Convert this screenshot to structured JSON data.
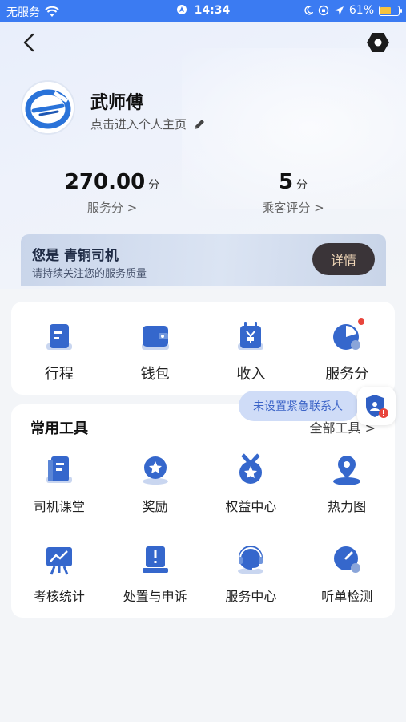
{
  "status_bar": {
    "carrier": "无服务",
    "time": "14:34",
    "battery": "61%",
    "battery_level": 0.61
  },
  "profile": {
    "name": "武师傅",
    "subtitle": "点击进入个人主页"
  },
  "stats": [
    {
      "value": "270.00",
      "unit": "分",
      "label": "服务分 >"
    },
    {
      "value": "5",
      "unit": "分",
      "label": "乘客评分 >"
    }
  ],
  "level_banner": {
    "title": "您是 青铜司机",
    "subtitle": "请持续关注您的服务质量",
    "detail_label": "详情"
  },
  "quick_items": [
    {
      "label": "行程",
      "icon": "itinerary-icon"
    },
    {
      "label": "钱包",
      "icon": "wallet-icon"
    },
    {
      "label": "收入",
      "icon": "income-icon"
    },
    {
      "label": "服务分",
      "icon": "service-score-icon",
      "has_badge": true
    }
  ],
  "tools": {
    "title": "常用工具",
    "all_label": "全部工具 >",
    "items": [
      {
        "label": "司机课堂",
        "icon": "driver-class-icon"
      },
      {
        "label": "奖励",
        "icon": "reward-icon"
      },
      {
        "label": "权益中心",
        "icon": "benefits-icon"
      },
      {
        "label": "热力图",
        "icon": "heatmap-icon"
      },
      {
        "label": "考核统计",
        "icon": "assessment-stats-icon"
      },
      {
        "label": "处置与申诉",
        "icon": "appeal-icon"
      },
      {
        "label": "服务中心",
        "icon": "service-center-icon"
      },
      {
        "label": "听单检测",
        "icon": "order-check-icon"
      }
    ]
  },
  "emergency_toast": {
    "text": "未设置紧急联系人",
    "icon": "shield-alert-icon"
  },
  "colors": {
    "accent": "#3b7bf2",
    "icon_blue": "#2f5fc4",
    "badge_red": "#e8453c",
    "detail_button_bg": "#3a3438"
  }
}
